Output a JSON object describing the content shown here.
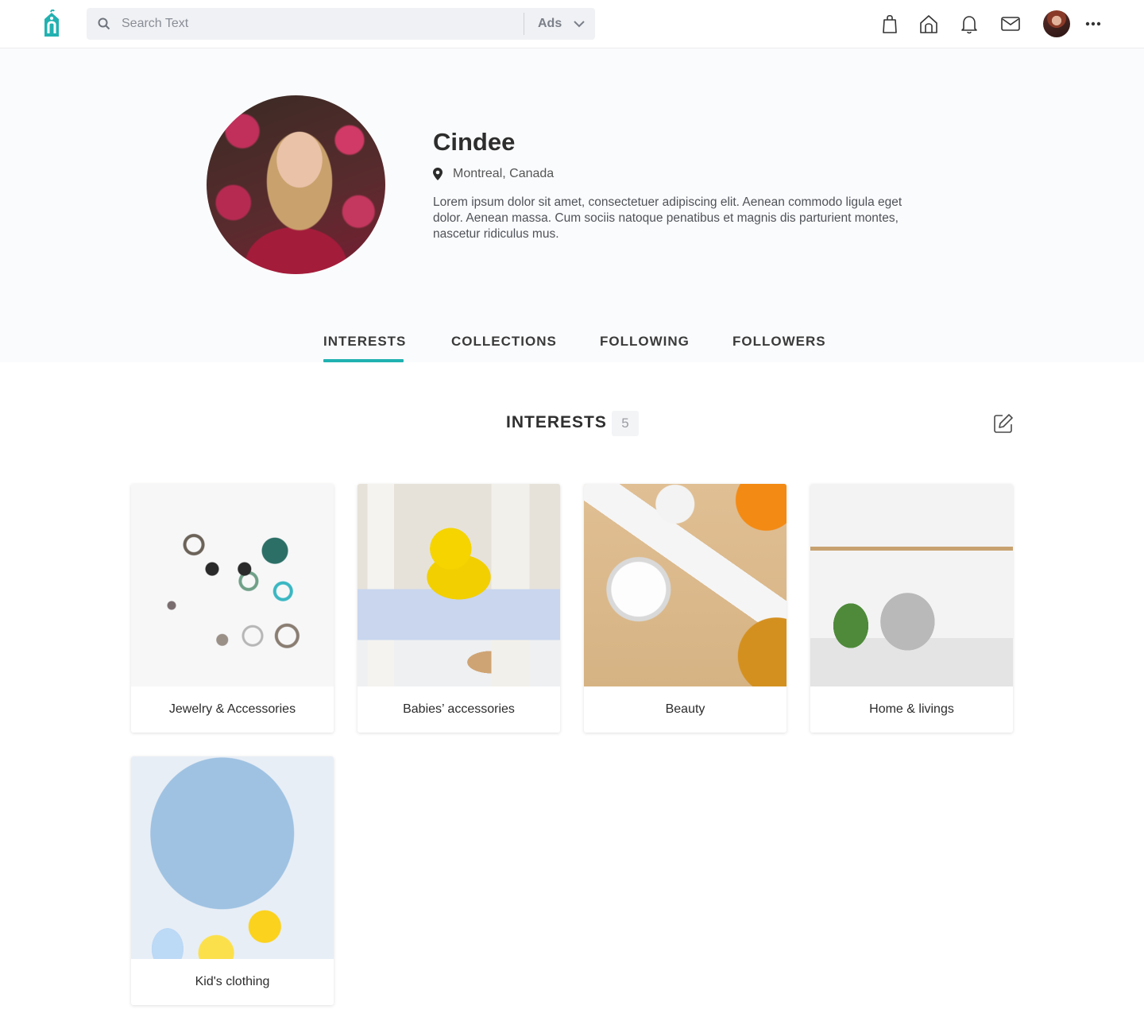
{
  "colors": {
    "accent": "#21b1b1"
  },
  "topbar": {
    "search_placeholder": "Search Text",
    "scope_label": "Ads",
    "icons": [
      "bag-icon",
      "home-icon",
      "bell-icon",
      "mail-icon",
      "avatar",
      "more-icon"
    ]
  },
  "profile": {
    "name": "Cindee",
    "location": "Montreal, Canada",
    "bio": "Lorem ipsum dolor sit amet, consectetuer adipiscing elit. Aenean commodo ligula eget dolor. Aenean massa. Cum sociis natoque penatibus et magnis dis parturient montes, nascetur ridiculus mus."
  },
  "tabs": [
    {
      "label": "INTERESTS",
      "active": true
    },
    {
      "label": "COLLECTIONS",
      "active": false
    },
    {
      "label": "FOLLOWING",
      "active": false
    },
    {
      "label": "FOLLOWERS",
      "active": false
    }
  ],
  "interests": {
    "title": "INTERESTS",
    "count": "5",
    "items": [
      {
        "label": "Jewelry & Accessories"
      },
      {
        "label": "Babies’ accessories"
      },
      {
        "label": "Beauty"
      },
      {
        "label": "Home & livings"
      },
      {
        "label": "Kid's clothing"
      }
    ]
  }
}
